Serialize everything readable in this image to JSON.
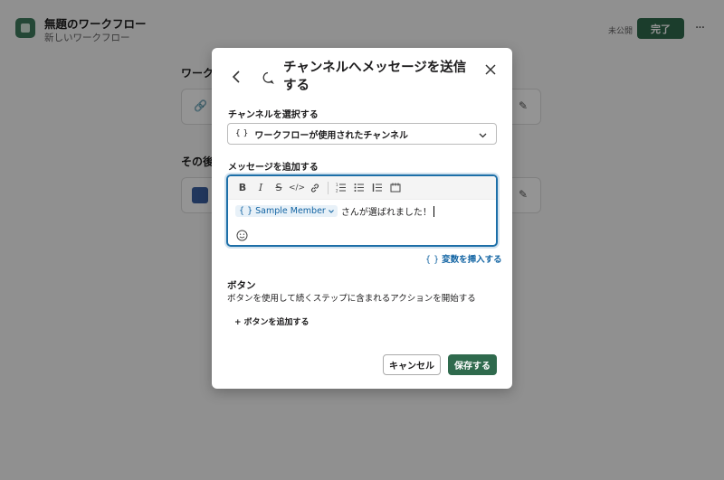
{
  "header": {
    "title": "無題のワークフロー",
    "subtitle": "新しいワークフロー",
    "status": "未公開",
    "done_label": "完了",
    "more_label": "···"
  },
  "background": {
    "section1_heading": "ワーク",
    "section2_heading": "その後"
  },
  "modal": {
    "title": "チャンネルへメッセージを送信する",
    "channel_label": "チャンネルを選択する",
    "channel_value": "ワークフローが使用されたチャンネル",
    "message_label": "メッセージを追加する",
    "message_variable": "Sample Member",
    "message_text": "さんが選ばれました！",
    "insert_variable": "変数を挿入する",
    "buttons_heading": "ボタン",
    "buttons_desc": "ボタンを使用して続くステップに含まれるアクションを開始する",
    "add_button": "ボタンを追加する",
    "cancel_label": "キャンセル",
    "save_label": "保存する"
  },
  "colors": {
    "brand_green": "#2f6a4d",
    "link_blue": "#1264a3",
    "focus_blue": "#1d6fa8"
  }
}
